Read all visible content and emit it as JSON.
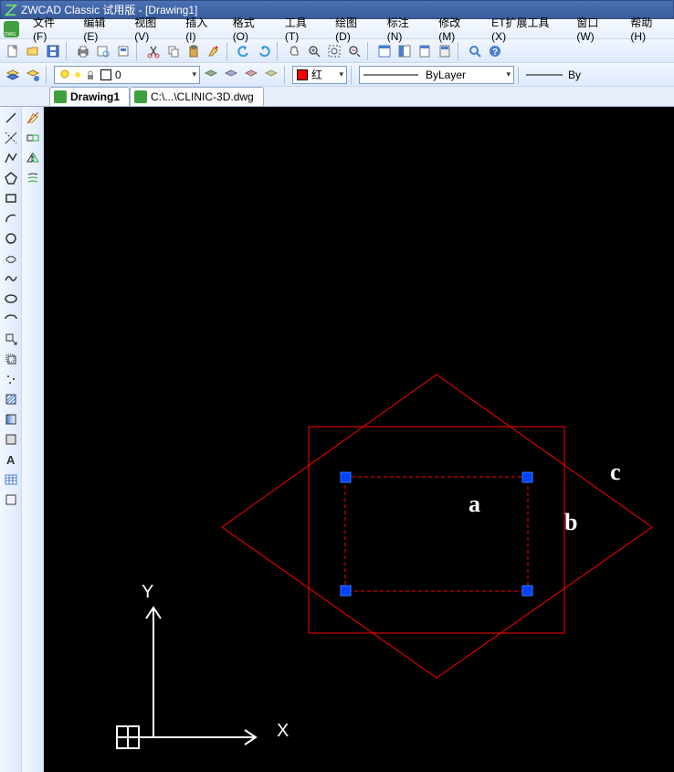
{
  "title": "ZWCAD Classic 试用版 - [Drawing1]",
  "menu": {
    "file": "文件(F)",
    "edit": "编辑(E)",
    "view": "视图(V)",
    "insert": "插入(I)",
    "format": "格式(O)",
    "tools": "工具(T)",
    "draw": "绘图(D)",
    "annotate": "标注(N)",
    "modify": "修改(M)",
    "et": "ET扩展工具(X)",
    "window": "窗口(W)",
    "help": "帮助(H)"
  },
  "layer_dropdown": "0",
  "color_dropdown": "红",
  "linetype_dropdown": "ByLayer",
  "lineweight_label": "By",
  "tabs": {
    "active": "Drawing1",
    "other": "C:\\...\\CLINIC-3D.dwg"
  },
  "annot": {
    "a": "a",
    "b": "b",
    "c": "c"
  },
  "axis": {
    "x": "X",
    "y": "Y"
  }
}
